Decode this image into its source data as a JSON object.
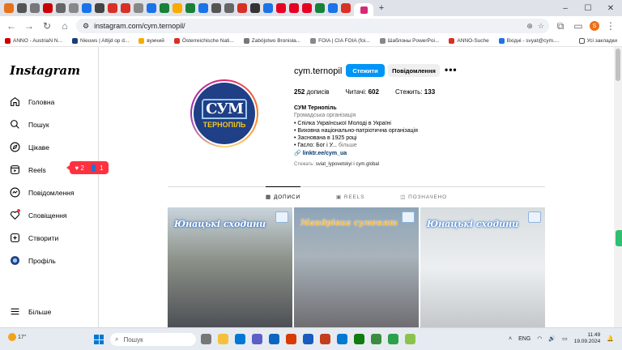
{
  "browser": {
    "url": "instagram.com/cym.ternopil/",
    "bookmarks": [
      "ANNO - AustriaN N...",
      "Nieuws | Altijd op d...",
      "вужчий",
      "Österreichische Nati...",
      "Zabójstwo Bronisła...",
      "FOIA | CIA FOIA (foi...",
      "Шаблоны PowerPoi...",
      "ANNO-Suche",
      "Вхідні - svyat@cym...."
    ],
    "bookmarks_folder": "Усі закладки",
    "profile_initial": "S"
  },
  "sidebar": {
    "logo": "Instagram",
    "items": [
      {
        "label": "Головна",
        "icon": "home-icon"
      },
      {
        "label": "Пошук",
        "icon": "search-icon"
      },
      {
        "label": "Цікаве",
        "icon": "compass-icon"
      },
      {
        "label": "Reels",
        "icon": "reels-icon"
      },
      {
        "label": "Повідомлення",
        "icon": "messenger-icon"
      },
      {
        "label": "Сповіщення",
        "icon": "heart-icon"
      },
      {
        "label": "Створити",
        "icon": "plus-icon"
      },
      {
        "label": "Профіль",
        "icon": "profile-icon"
      }
    ],
    "more_label": "Більше",
    "notif_likes": "2",
    "notif_follows": "1"
  },
  "profile": {
    "username": "cym.ternopil",
    "follow_label": "Стежити",
    "message_label": "Повідомлення",
    "posts_count": "252",
    "posts_label": "дописів",
    "followers_label": "Читачі:",
    "followers_count": "602",
    "following_label": "Стежить:",
    "following_count": "133",
    "avatar_text": "СУМ",
    "avatar_city": "ТЕРНОПІЛЬ",
    "display_name": "СУМ Тернопіль",
    "category": "Громадська організація",
    "bio_lines": [
      "• Спілка Української Молоді в Україні",
      "• Виховна національно-патріотична організація",
      "• Заснована в 1925 році",
      "• Гасло: Бог і У..."
    ],
    "bio_more": "більше",
    "link": "linktr.ee/cym_ua",
    "followed_by_prefix": "Стежать:",
    "followed_by": "sviat_lypovetskyi і cym.global"
  },
  "tabs": [
    {
      "label": "ДОПИСИ",
      "active": true
    },
    {
      "label": "REELS",
      "active": false
    },
    {
      "label": "ПОЗНАЧЕНО",
      "active": false
    }
  ],
  "posts": [
    {
      "caption": "Юнацькі сходини"
    },
    {
      "caption": "Мандрівка суменят"
    },
    {
      "caption": "Юнацькі сходини"
    }
  ],
  "taskbar": {
    "temperature": "17°",
    "search_placeholder": "Пошук",
    "language": "ENG",
    "time": "11:49",
    "date": "19.09.2024"
  }
}
